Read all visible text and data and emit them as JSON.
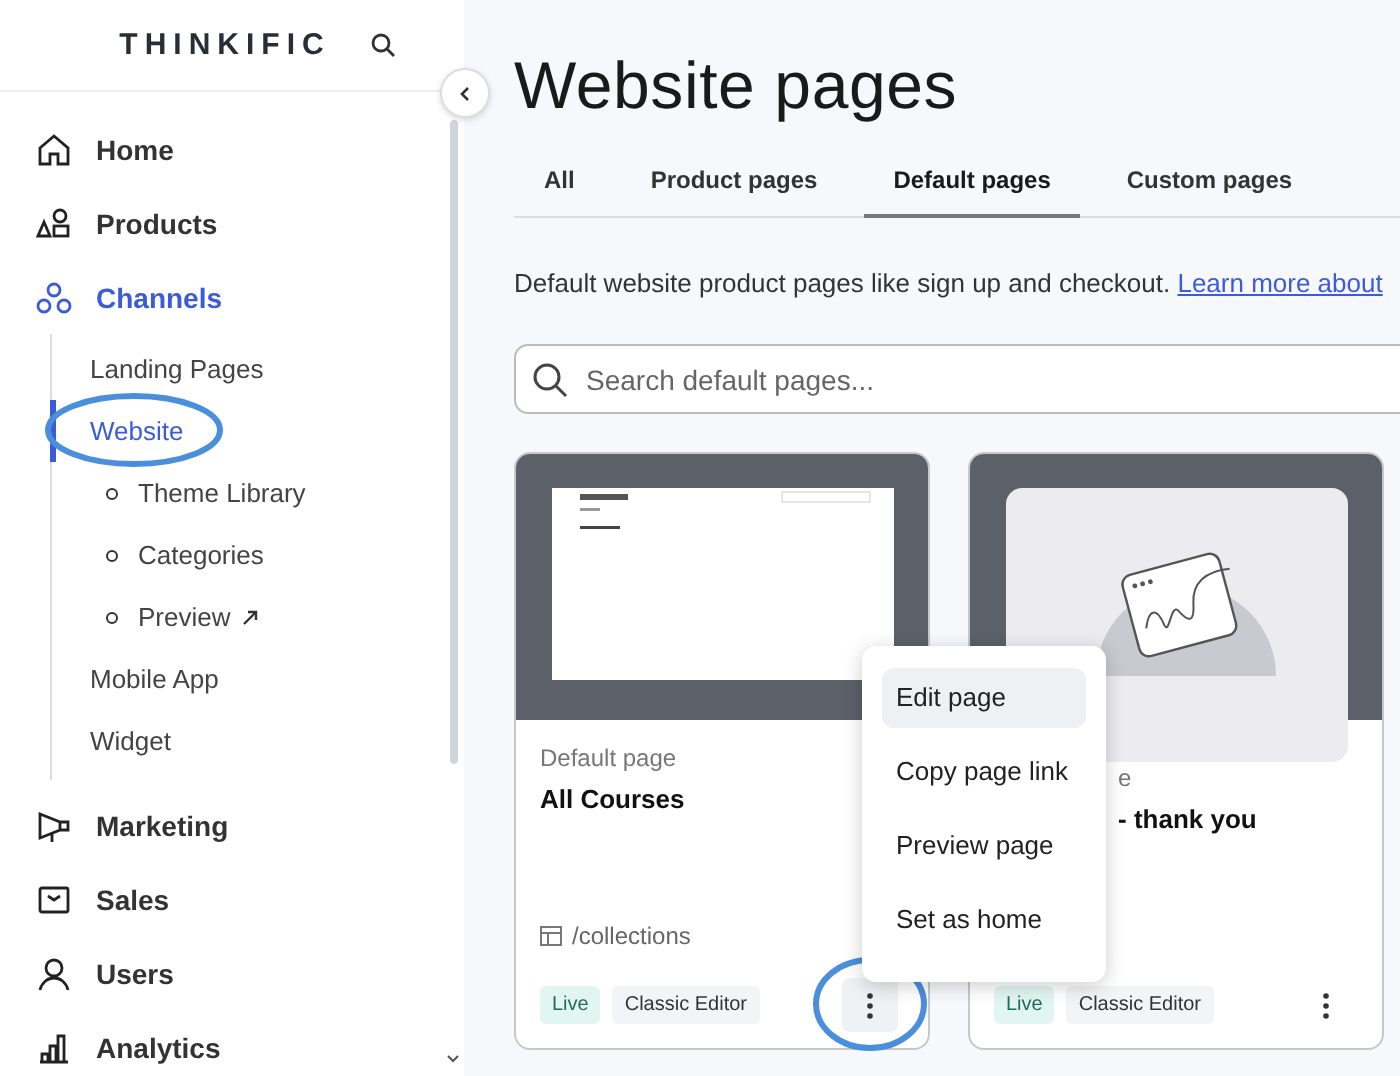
{
  "sidebar": {
    "logo": "THINKIFIC",
    "nav": [
      {
        "label": "Home",
        "selected": false
      },
      {
        "label": "Products",
        "selected": false
      },
      {
        "label": "Channels",
        "selected": true,
        "children": [
          {
            "label": "Landing Pages",
            "selected": false,
            "highlighted": false
          },
          {
            "label": "Website",
            "selected": true,
            "highlighted": true,
            "children": [
              {
                "label": "Theme Library",
                "external": false
              },
              {
                "label": "Categories",
                "external": false
              },
              {
                "label": "Preview",
                "external": true
              }
            ]
          },
          {
            "label": "Mobile App",
            "selected": false,
            "highlighted": false
          },
          {
            "label": "Widget",
            "selected": false,
            "highlighted": false
          }
        ]
      },
      {
        "label": "Marketing",
        "selected": false
      },
      {
        "label": "Sales",
        "selected": false
      },
      {
        "label": "Users",
        "selected": false
      },
      {
        "label": "Analytics",
        "selected": false
      }
    ]
  },
  "main": {
    "title": "Website pages",
    "tabs": [
      {
        "label": "All",
        "selected": false
      },
      {
        "label": "Product pages",
        "selected": false
      },
      {
        "label": "Default pages",
        "selected": true
      },
      {
        "label": "Custom pages",
        "selected": false
      }
    ],
    "description": "Default website product pages like sign up and checkout.",
    "link": "Learn more about",
    "search": {
      "placeholder": "Search default pages..."
    },
    "cards": [
      {
        "kind": "page",
        "type_label": "Default page",
        "title": "All Courses",
        "path": "/collections",
        "badges": [
          {
            "label": "Live",
            "kind": "live"
          },
          {
            "label": "Classic Editor",
            "kind": "editor"
          }
        ],
        "menu_highlighted": true
      },
      {
        "kind": "illustration",
        "type_label": "e",
        "title": "- thank you",
        "badges": [
          {
            "label": "Live",
            "kind": "live"
          },
          {
            "label": "Classic Editor",
            "kind": "editor"
          }
        ],
        "menu_highlighted": false
      }
    ],
    "menu": {
      "items": [
        {
          "label": "Edit page",
          "hovered": true
        },
        {
          "label": "Copy page link",
          "hovered": false
        },
        {
          "label": "Preview page",
          "hovered": false
        },
        {
          "label": "Set as home",
          "hovered": false
        }
      ]
    }
  }
}
